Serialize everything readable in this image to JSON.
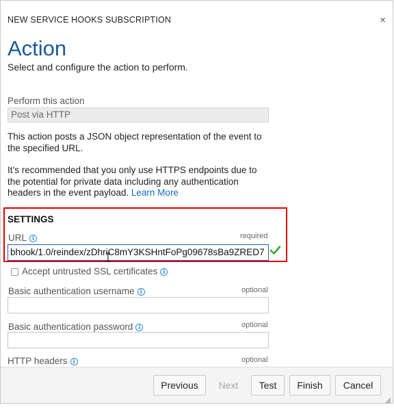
{
  "dialog": {
    "title": "NEW SERVICE HOOKS SUBSCRIPTION",
    "close_glyph": "×",
    "heading": "Action",
    "subtitle": "Select and configure the action to perform."
  },
  "action": {
    "label": "Perform this action",
    "value": "Post via HTTP",
    "description": "This action posts a JSON object representation of the event to the specified URL.",
    "recommendation": "It’s recommended that you only use HTTPS endpoints due to the potential for private data including any authentication headers in the event payload.",
    "learn_more": "Learn More"
  },
  "settings": {
    "title": "SETTINGS",
    "url": {
      "label": "URL",
      "hint": "required",
      "value": "bhook/1.0/reindex/zDhriC8mY3KSHntFoPg09678sBa9ZRED7"
    },
    "ssl_checkbox": {
      "label": "Accept untrusted SSL certificates",
      "checked": false
    },
    "username": {
      "label": "Basic authentication username",
      "hint": "optional",
      "value": ""
    },
    "password": {
      "label": "Basic authentication password",
      "hint": "optional",
      "value": ""
    },
    "headers": {
      "label": "HTTP headers",
      "hint": "optional"
    }
  },
  "footer": {
    "previous": "Previous",
    "next": "Next",
    "test": "Test",
    "finish": "Finish",
    "cancel": "Cancel"
  },
  "icons": {
    "info": "info-icon",
    "check": "checkmark-icon",
    "close": "close-icon",
    "resize": "resize-grip-icon"
  },
  "colors": {
    "heading": "#1a5a96",
    "link": "#106ebe",
    "highlight_frame": "#e00000",
    "valid_check": "#3aa832"
  }
}
